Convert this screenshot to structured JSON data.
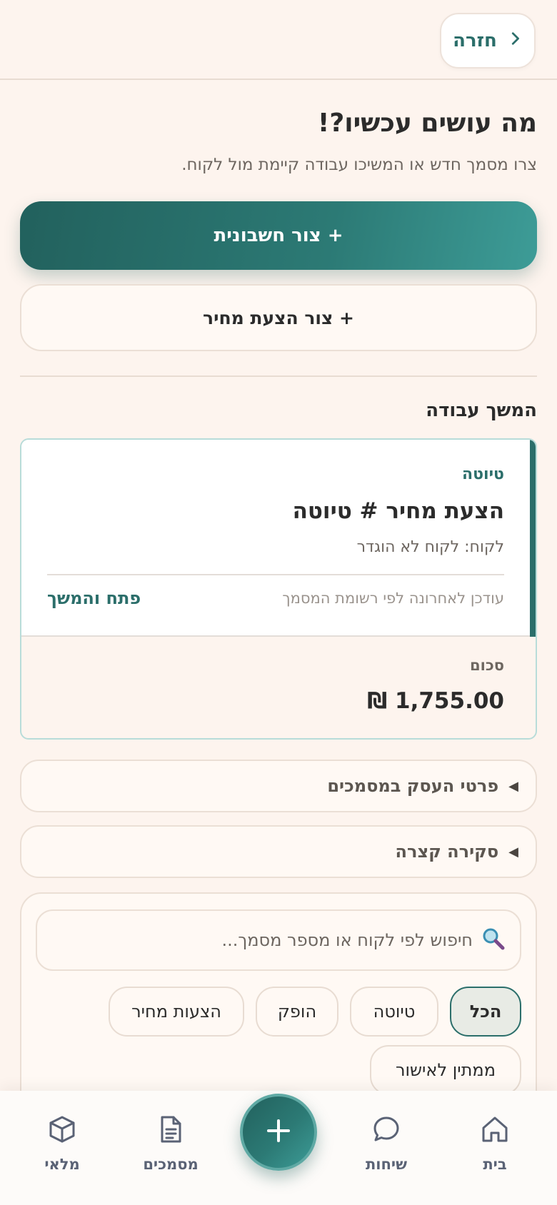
{
  "header": {
    "back_label": "חזרה"
  },
  "hero": {
    "title": "מה עושים עכשיו?!",
    "subtitle": "צרו מסמך חדש או המשיכו עבודה קיימת מול לקוח."
  },
  "actions": {
    "create_invoice": "+ צור חשבונית",
    "create_quote": "+ צור הצעת מחיר"
  },
  "continue_section": {
    "title": "המשך עבודה",
    "card": {
      "status": "טיוטה",
      "title": "הצעת מחיר # טיוטה",
      "client": "לקוח: לקוח לא הוגדר",
      "updated": "עודכן לאחרונה לפי רשומת המסמך",
      "open_label": "פתח והמשך",
      "sum_label": "סכום",
      "sum_value": "₪ 1,755.00"
    }
  },
  "collapsibles": {
    "business_details": "פרטי העסק במסמכים",
    "quick_overview": "סקירה קצרה"
  },
  "filters": {
    "search_placeholder": "חיפוש לפי לקוח או מספר מסמך...",
    "chips": {
      "all": "הכל",
      "draft": "טיוטה",
      "issued": "הופק",
      "quotes": "הצעות מחיר",
      "pending": "ממתין לאישור"
    }
  },
  "bottom_nav": {
    "home": "בית",
    "chats": "שיחות",
    "documents": "מסמכים",
    "inventory": "מלאי"
  },
  "colors": {
    "primary": "#2b6e6a",
    "background": "#fdf4ee",
    "nav_icon": "#5a6275"
  },
  "icons": {
    "back": "chevron-right-icon",
    "search": "magnifier-icon",
    "home": "home-icon",
    "chats": "chat-bubble-icon",
    "documents": "document-icon",
    "inventory": "box-icon",
    "fab": "plus-icon",
    "collapse": "triangle-left-icon"
  }
}
